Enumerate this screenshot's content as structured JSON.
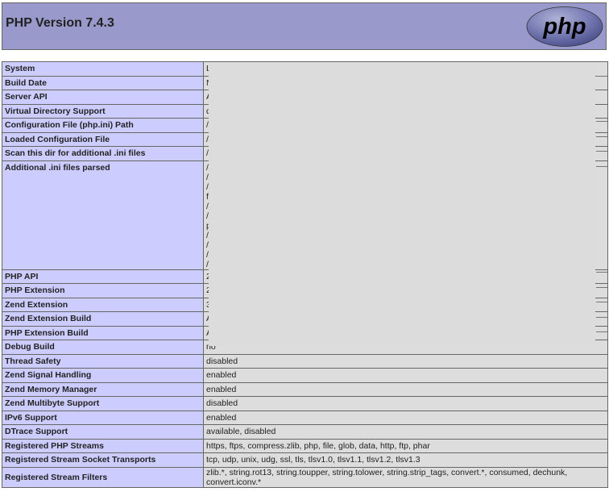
{
  "header": {
    "title": "PHP Version 7.4.3",
    "logo_text": "php"
  },
  "rows": [
    {
      "key": "System",
      "value": "L"
    },
    {
      "key": "Build Date",
      "value": "N"
    },
    {
      "key": "Server API",
      "value": "A"
    },
    {
      "key": "Virtual Directory Support",
      "value": "d"
    },
    {
      "key": "Configuration File (php.ini) Path",
      "value": "/"
    },
    {
      "key": "Loaded Configuration File",
      "value": "/"
    },
    {
      "key": "Scan this dir for additional .ini files",
      "value": "/"
    },
    {
      "key": "Additional .ini files parsed",
      "value": "/\n/\n/\nf\n/\n/\np\n/\n/\n/\n/"
    },
    {
      "key": "PHP API",
      "value": "2"
    },
    {
      "key": "PHP Extension",
      "value": "2"
    },
    {
      "key": "Zend Extension",
      "value": "3"
    },
    {
      "key": "Zend Extension Build",
      "value": "A"
    },
    {
      "key": "PHP Extension Build",
      "value": "A"
    },
    {
      "key": "Debug Build",
      "value": "no"
    },
    {
      "key": "Thread Safety",
      "value": "disabled"
    },
    {
      "key": "Zend Signal Handling",
      "value": "enabled"
    },
    {
      "key": "Zend Memory Manager",
      "value": "enabled"
    },
    {
      "key": "Zend Multibyte Support",
      "value": "disabled"
    },
    {
      "key": "IPv6 Support",
      "value": "enabled"
    },
    {
      "key": "DTrace Support",
      "value": "available, disabled"
    },
    {
      "key": "Registered PHP Streams",
      "value": "https, ftps, compress.zlib, php, file, glob, data, http, ftp, phar"
    },
    {
      "key": "Registered Stream Socket Transports",
      "value": "tcp, udp, unix, udg, ssl, tls, tlsv1.0, tlsv1.1, tlsv1.2, tlsv1.3"
    },
    {
      "key": "Registered Stream Filters",
      "value": "zlib.*, string.rot13, string.toupper, string.tolower, string.strip_tags, convert.*, consumed, dechunk, convert.iconv.*"
    }
  ],
  "colors": {
    "header_bg": "#9999cc",
    "key_bg": "#ccccff",
    "value_bg": "#dddddd",
    "redaction": "#dcdcdc"
  }
}
